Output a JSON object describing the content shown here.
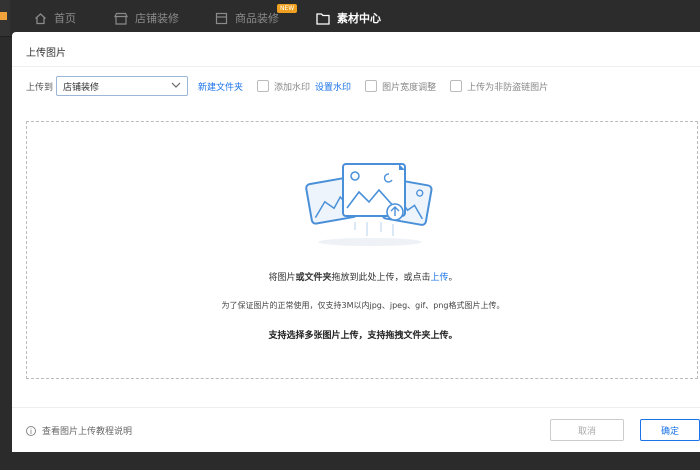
{
  "nav": {
    "items": [
      {
        "label": "首页",
        "icon": "home-icon"
      },
      {
        "label": "店铺装修",
        "icon": "store-icon"
      },
      {
        "label": "商品装修",
        "icon": "product-icon",
        "badge": "NEW"
      },
      {
        "label": "素材中心",
        "icon": "folder-icon",
        "active": true
      }
    ]
  },
  "modal": {
    "title": "上传图片",
    "upload_to_label": "上传到",
    "folder_select_value": "店铺装修",
    "new_folder_link": "新建文件夹",
    "add_watermark": "添加水印",
    "set_watermark_link": "设置水印",
    "adjust_width": "图片宽度调整",
    "non_hotlink": "上传为非防盗链图片",
    "drop_msg_prefix": "将图片",
    "drop_msg_bold": "或文件夹",
    "drop_msg_middle": "拖放到此处上传，或点击",
    "drop_msg_link": "上传",
    "drop_msg_suffix": "。",
    "format_note": "为了保证图片的正常使用，仅支持3M以内jpg、jpeg、gif、png格式图片上传。",
    "multi_note": "支持选择多张图片上传，支持拖拽文件夹上传。",
    "help_text": "查看图片上传教程说明",
    "cancel_label": "取消",
    "ok_label": "确定"
  },
  "colors": {
    "accent": "#1a73e8",
    "illustration": "#4a90d9",
    "nav_bg": "#2c2c2c"
  }
}
